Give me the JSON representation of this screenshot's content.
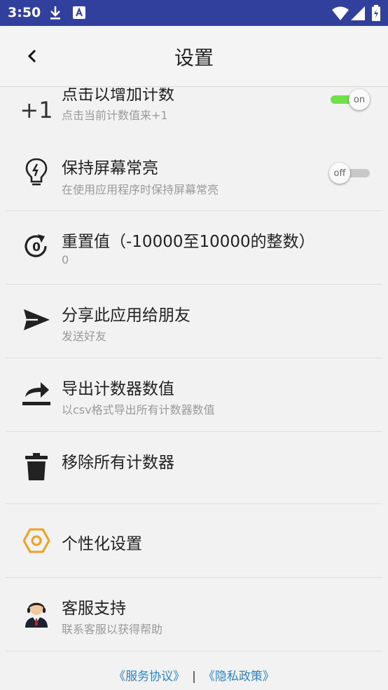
{
  "status_bar": {
    "time": "3:50"
  },
  "header": {
    "title": "设置"
  },
  "settings": {
    "increment": {
      "icon_text": "+1",
      "title": "点击以增加计数",
      "subtitle": "点击当前计数值来+1",
      "toggle_label": "on",
      "enabled": true
    },
    "screen_on": {
      "title": "保持屏幕常亮",
      "subtitle": "在使用应用程序时保持屏幕常亮",
      "toggle_label": "off",
      "enabled": false
    },
    "reset_value": {
      "icon_text": "0",
      "title": "重置值（-10000至10000的整数）",
      "subtitle": "0"
    },
    "share": {
      "title": "分享此应用给朋友",
      "subtitle": "发送好友"
    },
    "export": {
      "title": "导出计数器数值",
      "subtitle": "以csv格式导出所有计数器数值"
    },
    "remove_all": {
      "title": "移除所有计数器"
    },
    "personalize": {
      "title": "个性化设置"
    },
    "support": {
      "title": "客服支持",
      "subtitle": "联系客服以获得帮助"
    }
  },
  "footer": {
    "terms": "《服务协议》",
    "separator": "|",
    "privacy": "《隐私政策》"
  },
  "colors": {
    "status_bar": "#30409c",
    "toggle_on": "#6ee04a",
    "accent_hex": "#f0a020",
    "link": "#2e84c4"
  }
}
